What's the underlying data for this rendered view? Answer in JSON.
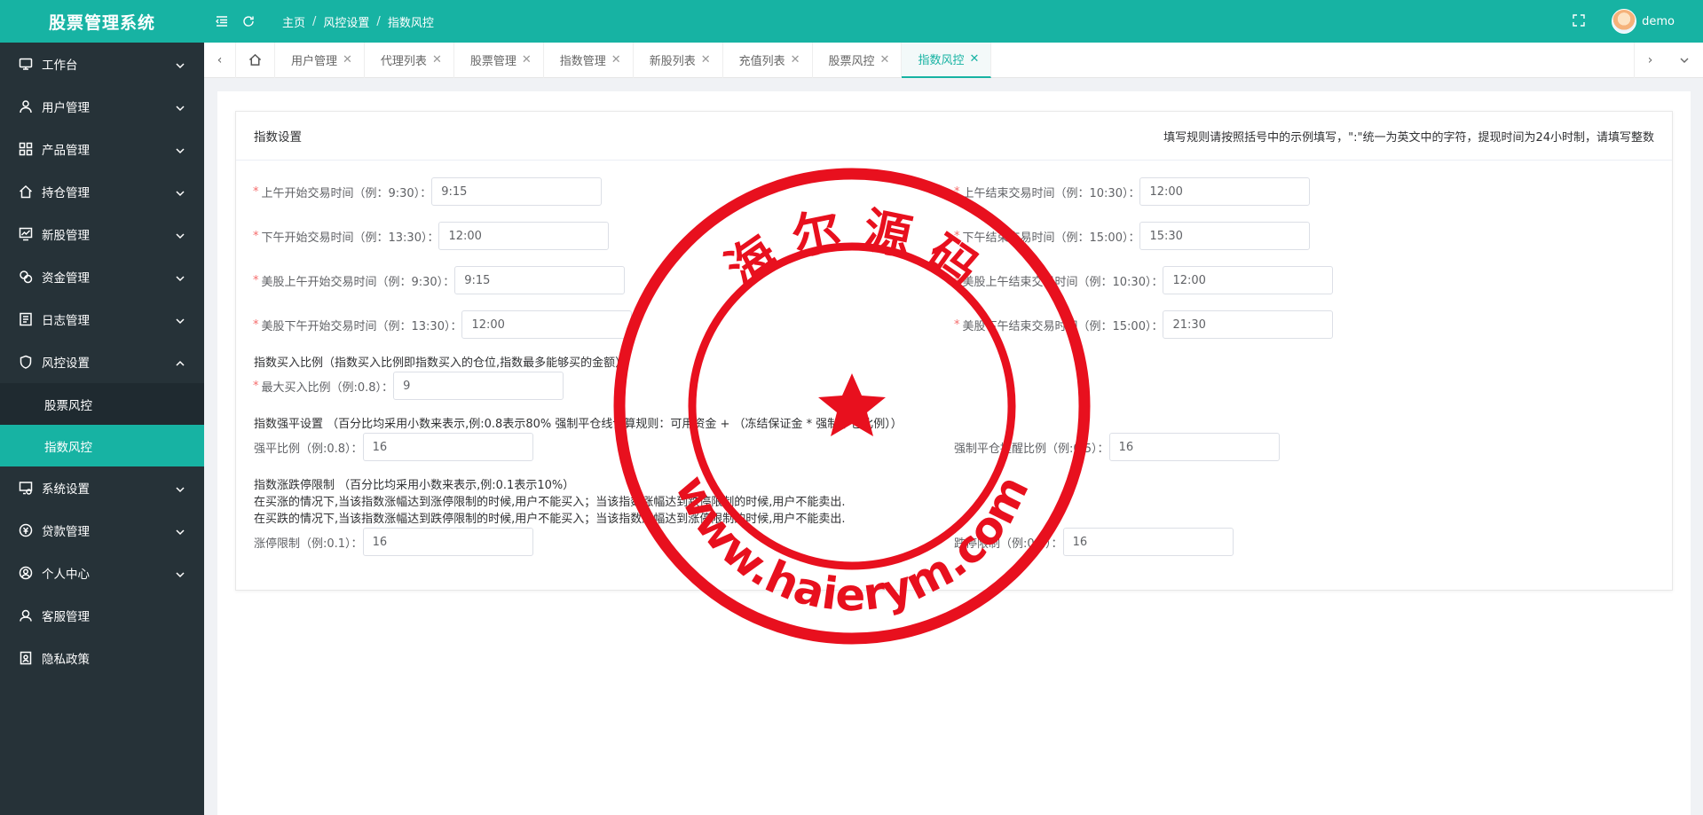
{
  "app": {
    "title": "股票管理系统"
  },
  "header": {
    "breadcrumbs": [
      "主页",
      "风控设置",
      "指数风控"
    ],
    "breadcrumb_sep": "/",
    "user": "demo"
  },
  "sidebar": {
    "items": [
      {
        "label": "工作台",
        "icon": "monitor-icon"
      },
      {
        "label": "用户管理",
        "icon": "user-icon"
      },
      {
        "label": "产品管理",
        "icon": "grid-icon"
      },
      {
        "label": "持仓管理",
        "icon": "home-icon"
      },
      {
        "label": "新股管理",
        "icon": "chart-icon"
      },
      {
        "label": "资金管理",
        "icon": "coins-icon"
      },
      {
        "label": "日志管理",
        "icon": "log-icon"
      },
      {
        "label": "风控设置",
        "icon": "shield-icon"
      }
    ],
    "submenu": [
      {
        "label": "股票风控"
      },
      {
        "label": "指数风控"
      }
    ],
    "items_after": [
      {
        "label": "系统设置",
        "icon": "settings-icon"
      },
      {
        "label": "贷款管理",
        "icon": "loan-icon"
      },
      {
        "label": "个人中心",
        "icon": "person-icon"
      },
      {
        "label": "客服管理",
        "icon": "service-icon"
      },
      {
        "label": "隐私政策",
        "icon": "privacy-icon"
      }
    ]
  },
  "tabs": [
    {
      "label": "用户管理"
    },
    {
      "label": "代理列表"
    },
    {
      "label": "股票管理"
    },
    {
      "label": "指数管理"
    },
    {
      "label": "新股列表"
    },
    {
      "label": "充值列表"
    },
    {
      "label": "股票风控"
    },
    {
      "label": "指数风控"
    }
  ],
  "panel": {
    "title": "指数设置",
    "rule": "填写规则请按照括号中的示例填写，\":\"统一为英文中的字符，提现时间为24小时制，请填写整数"
  },
  "form": {
    "am_start": {
      "label": "上午开始交易时间（例：9:30）：",
      "value": "9:15"
    },
    "am_end": {
      "label": "上午结束交易时间（例：10:30）：",
      "value": "12:00"
    },
    "pm_start": {
      "label": "下午开始交易时间（例：13:30）：",
      "value": "12:00"
    },
    "pm_end": {
      "label": "下午结束交易时间（例：15:00）：",
      "value": "15:30"
    },
    "us_am_start": {
      "label": "美股上午开始交易时间（例：9:30）：",
      "value": "9:15"
    },
    "us_am_end": {
      "label": "美股上午结束交易时间（例：10:30）：",
      "value": "12:00"
    },
    "us_pm_start": {
      "label": "美股下午开始交易时间（例：13:30）：",
      "value": "12:00"
    },
    "us_pm_end": {
      "label": "美股下午结束交易时间（例：15:00）：",
      "value": "21:30"
    },
    "buy_ratio_note": "指数买入比例（指数买入比例即指数买入的仓位,指数最多能够买的金额）",
    "max_buy": {
      "label": "最大买入比例（例:0.8）：",
      "value": "9"
    },
    "force_note": "指数强平设置 （百分比均采用小数来表示,例:0.8表示80% 强制平仓线计算规则：可用资金 + （冻结保证金 * 强制平仓比例））",
    "force_ratio": {
      "label": "强平比例（例:0.8）：",
      "value": "16"
    },
    "force_warn": {
      "label": "强制平仓提醒比例（例:0.5）：",
      "value": "16"
    },
    "limit_note_1": "指数涨跌停限制 （百分比均采用小数来表示,例:0.1表示10%）",
    "limit_note_2": "在买涨的情况下,当该指数涨幅达到涨停限制的时候,用户不能买入；当该指数涨幅达到跌停限制的时候,用户不能卖出.",
    "limit_note_3": "在买跌的情况下,当该指数涨幅达到跌停限制的时候,用户不能买入；当该指数涨幅达到涨停限制的时候,用户不能卖出.",
    "up_limit": {
      "label": "涨停限制（例:0.1）：",
      "value": "16"
    },
    "down_limit": {
      "label": "跌停限制（例:0.1）：",
      "value": "16"
    }
  },
  "stamp": {
    "top_text": "海 尔 源 码",
    "bottom_text": "www.haierym.com",
    "color": "#e8101e"
  },
  "colors": {
    "accent": "#17b3a3",
    "sidebar": "#263238"
  }
}
